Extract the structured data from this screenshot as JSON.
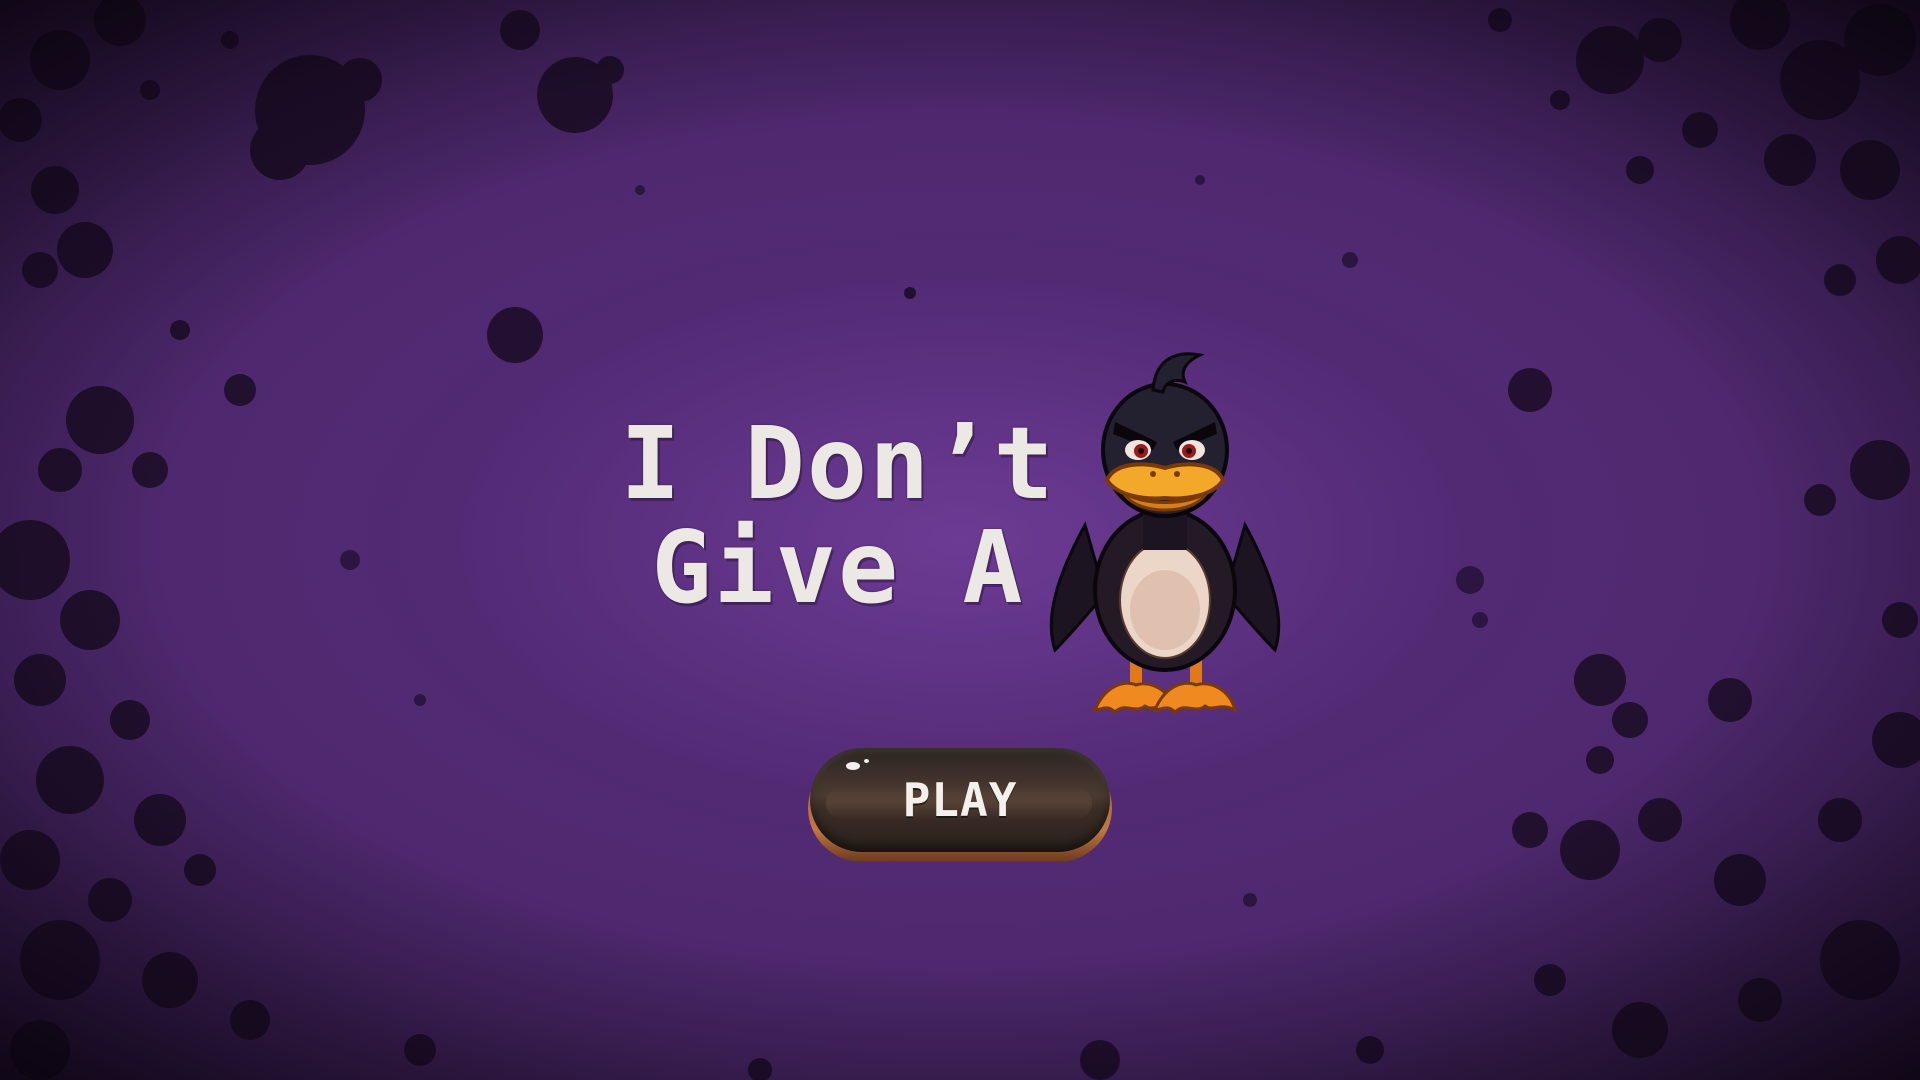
{
  "game": {
    "title_line_1": "I Don’t",
    "title_line_2": "Give A",
    "mascot_icon": "angry-duck-icon",
    "play_label": "PLAY"
  },
  "colors": {
    "background": "#4a2768",
    "title_text": "#ece8e4",
    "button_body": "#3b2d26",
    "button_rim": "#c17840",
    "duck_beak": "#f0a020"
  }
}
